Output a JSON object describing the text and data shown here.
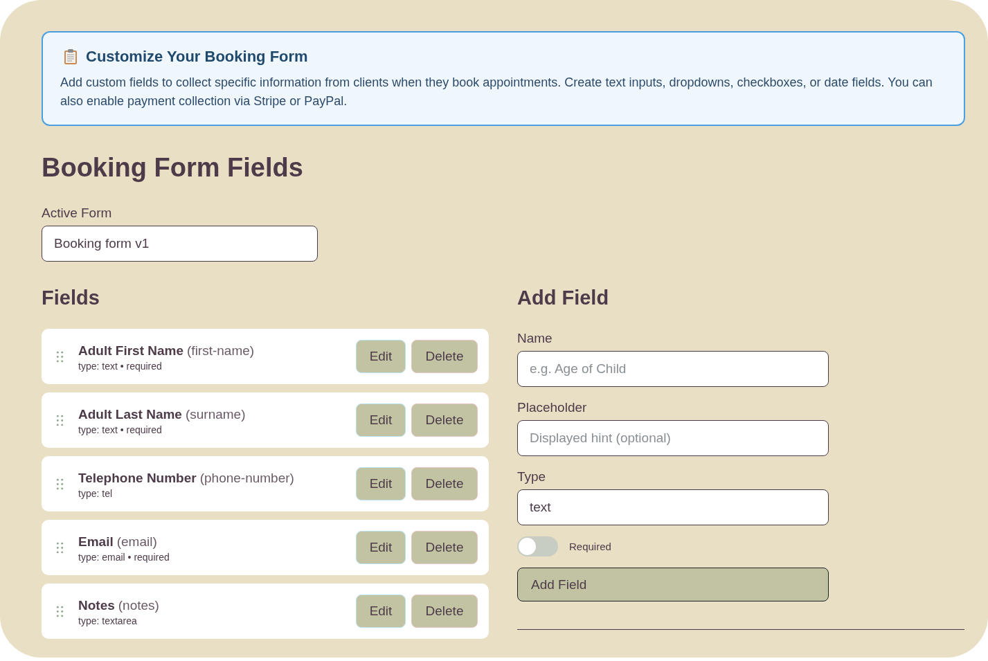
{
  "info": {
    "title": "Customize Your Booking Form",
    "text": "Add custom fields to collect specific information from clients when they book appointments. Create text inputs, dropdowns, checkboxes, or date fields. You can also enable payment collection via Stripe or PayPal."
  },
  "heading": "Booking Form Fields",
  "active_form": {
    "label": "Active Form",
    "value": "Booking form v1"
  },
  "fields": {
    "title": "Fields",
    "items": [
      {
        "name": "Adult First Name",
        "slug": "(first-name)",
        "meta": "type: text • required",
        "buttons": [
          "Edit",
          "Delete"
        ]
      },
      {
        "name": "Adult Last Name",
        "slug": "(surname)",
        "meta": "type: text • required",
        "buttons": [
          "Edit",
          "Delete"
        ]
      },
      {
        "name": "Telephone Number",
        "slug": "(phone-number)",
        "meta": "type: tel",
        "buttons": [
          "Edit",
          "Delete"
        ]
      },
      {
        "name": "Email",
        "slug": "(email)",
        "meta": "type: email • required",
        "buttons": [
          "Edit",
          "Delete"
        ]
      },
      {
        "name": "Notes",
        "slug": "(notes)",
        "meta": "type: textarea",
        "buttons": [
          "Edit",
          "Delete"
        ]
      }
    ]
  },
  "add_field": {
    "title": "Add Field",
    "inputs": [
      {
        "label": "Name",
        "placeholder": "e.g. Age of Child"
      },
      {
        "label": "Placeholder",
        "placeholder": "Displayed hint (optional)"
      },
      {
        "label": "Type",
        "value": "text"
      }
    ],
    "required_toggle": {
      "label": "Required",
      "on": false
    },
    "submit": "Add Field"
  }
}
